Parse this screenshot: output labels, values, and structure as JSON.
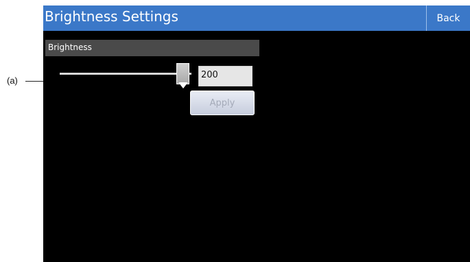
{
  "callout": {
    "label": "(a)"
  },
  "header": {
    "title": "Brightness Settings",
    "back_label": "Back"
  },
  "brightness": {
    "section_label": "Brightness",
    "value": "200",
    "apply_label": "Apply"
  },
  "colors": {
    "title_bar": "#3b78c8",
    "screen_background": "#000000",
    "section_header": "#4a4a4a"
  }
}
